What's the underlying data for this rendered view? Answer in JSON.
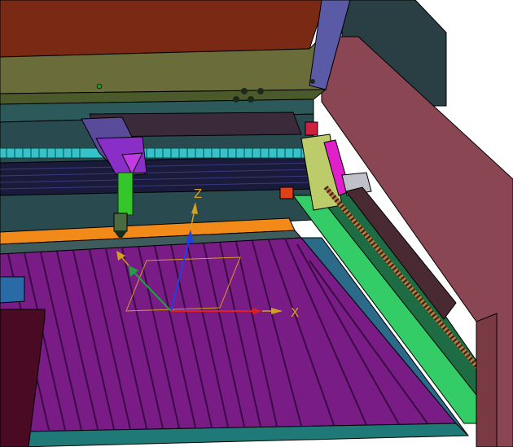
{
  "viewport": {
    "axis_labels": {
      "x": "X",
      "z": "Z"
    }
  },
  "colors": {
    "background": "#ffffff",
    "lid_interior": "#7a2a14",
    "lid_frame": "#6a6d3a",
    "side_panel": "#8a4652",
    "side_panel_dark": "#2a3f44",
    "bed_blade": "#7a1c86",
    "bed_shadow": "#3a0a44",
    "gantry": "#1a1a3a",
    "ball_screw": "#35c2c8",
    "laser_head": "#8a2ec8",
    "nozzle": "#34c62a",
    "rail_green": "#33cc66",
    "orange_strip": "#f28a1a",
    "y_carriage": "#bccc6a",
    "magenta_block": "#e020c8",
    "axis_x": "#e02020",
    "axis_y": "#20a040",
    "axis_z": "#2040e0",
    "triad_label": "#d4a020"
  }
}
